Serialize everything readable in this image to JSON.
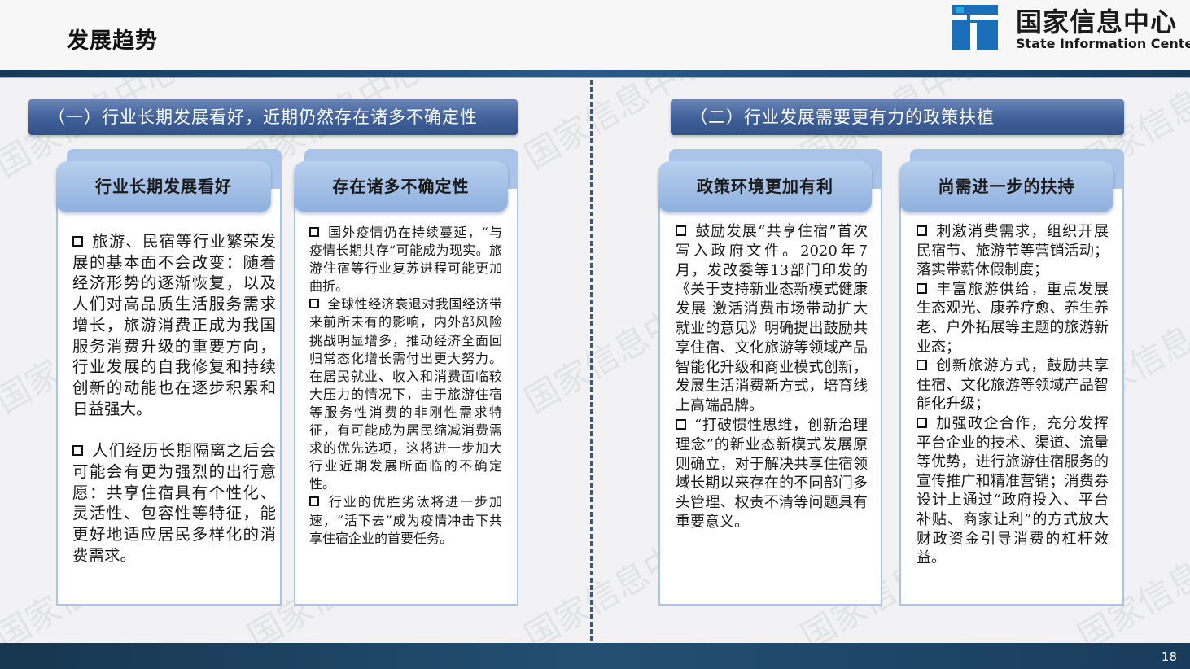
{
  "header": {
    "title": "发展趋势",
    "logo_cn": "国家信息中心",
    "logo_en": "State Information Center"
  },
  "watermark": "国家信息中心",
  "sections": [
    {
      "banner": "（一）行业长期发展看好，近期仍然存在诸多不确定性",
      "cards": [
        {
          "title": "行业长期发展看好",
          "paragraphs": [
            "旅游、民宿等行业繁荣发展的基本面不会改变：随着经济形势的逐渐恢复，以及人们对高品质生活服务需求增长，旅游消费正成为我国服务消费升级的重要方向，行业发展的自我修复和持续创新的动能也在逐步积累和日益强大。",
            "人们经历长期隔离之后会可能会有更为强烈的出行意愿：共享住宿具有个性化、灵活性、包容性等特征，能更好地适应居民多样化的消费需求。"
          ]
        },
        {
          "title": "存在诸多不确定性",
          "paragraphs": [
            "国外疫情仍在持续蔓延，“与疫情长期共存”可能成为现实。旅游住宿等行业复苏进程可能更加曲折。",
            "全球性经济衰退对我国经济带来前所未有的影响，内外部风险挑战明显增多，推动经济全面回归常态化增长需付出更大努力。在居民就业、收入和消费面临较大压力的情况下，由于旅游住宿等服务性消费的非刚性需求特征，有可能成为居民缩减消费需求的优先选项，这将进一步加大行业近期发展所面临的不确定性。",
            "行业的优胜劣汰将进一步加速，“活下去”成为疫情冲击下共享住宿企业的首要任务。"
          ]
        }
      ]
    },
    {
      "banner": "（二）行业发展需要更有力的政策扶植",
      "cards": [
        {
          "title": "政策环境更加有利",
          "paragraphs": [
            "鼓励发展“共享住宿”首次写入政府文件。2020年7月，发改委等13部门印发的《关于支持新业态新模式健康发展 激活消费市场带动扩大就业的意见》明确提出鼓励共享住宿、文化旅游等领域产品智能化升级和商业模式创新，发展生活消费新方式，培育线上高端品牌。",
            "“打破惯性思维，创新治理理念”的新业态新模式发展原则确立，对于解决共享住宿领域长期以来存在的不同部门多头管理、权责不清等问题具有重要意义。"
          ]
        },
        {
          "title": "尚需进一步的扶持",
          "paragraphs": [
            "刺激消费需求，组织开展民宿节、旅游节等营销活动；落实带薪休假制度；",
            "丰富旅游供给，重点发展生态观光、康养疗愈、养生养老、户外拓展等主题的旅游新业态；",
            "创新旅游方式，鼓励共享住宿、文化旅游等领域产品智能化升级；",
            "加强政企合作，充分发挥平台企业的技术、渠道、流量等优势，进行旅游住宿服务的宣传推广和精准营销；消费券设计上通过“政府投入、平台补贴、商家让利”的方式放大财政资金引导消费的杠杆效益。"
          ]
        }
      ]
    }
  ],
  "footer": {
    "page_number": "18"
  },
  "colors": {
    "banner": "#3f5f98",
    "card_header": "#9fbde4",
    "card_border": "#a9c4e8",
    "header_rule": "#1f4a73",
    "footer": "#1d4463"
  }
}
